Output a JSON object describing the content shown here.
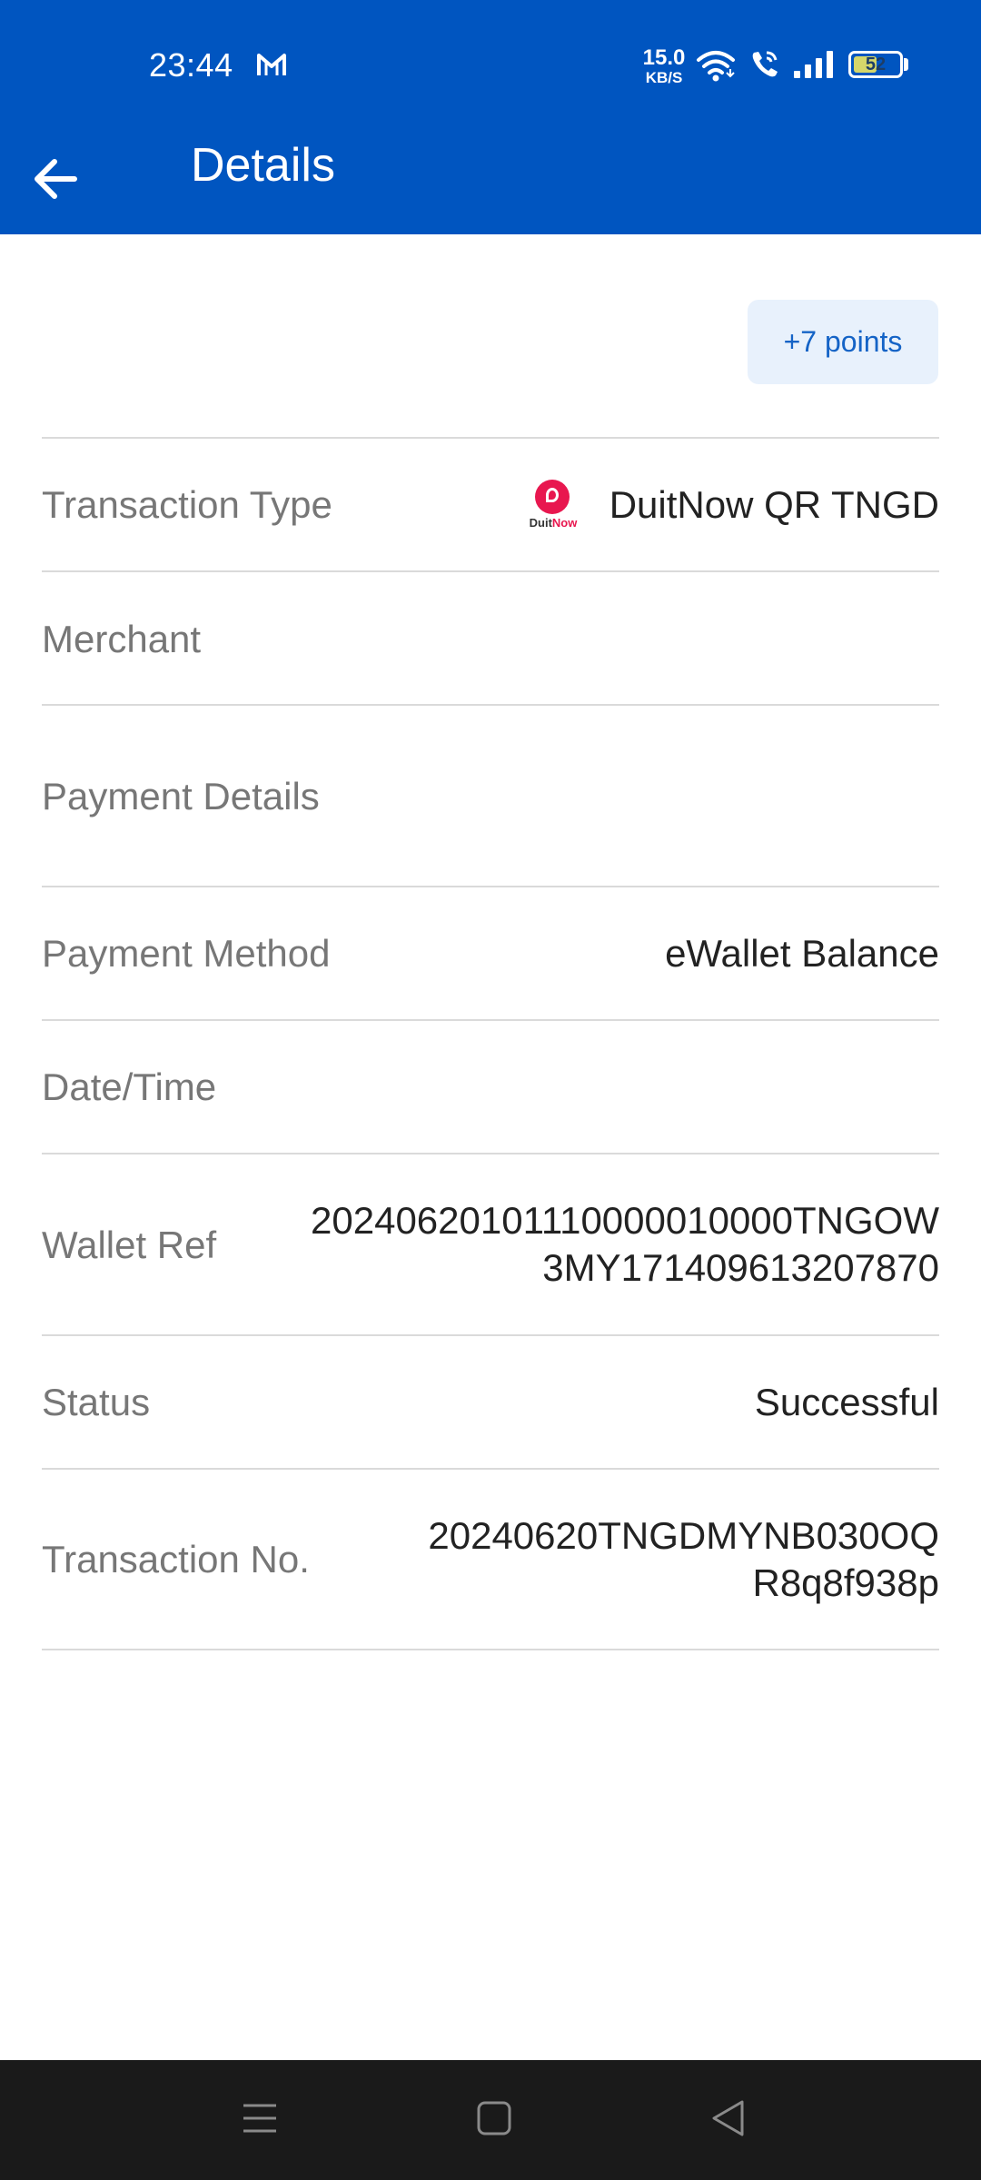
{
  "status_bar": {
    "time": "23:44",
    "net_speed_value": "15.0",
    "net_speed_unit": "KB/S",
    "battery": "52",
    "battery_level": 0.52,
    "icons": [
      "gmail-icon",
      "wifi-icon",
      "wifi-call-icon",
      "signal-icon",
      "battery-icon"
    ]
  },
  "app_bar": {
    "title": "Details",
    "back_icon": "arrow-left-icon"
  },
  "points": "+7 points",
  "rows": {
    "transaction_type": {
      "label": "Transaction Type",
      "value": "DuitNow QR TNGD",
      "logo_text_a": "Duit",
      "logo_text_b": "Now"
    },
    "merchant": {
      "label": "Merchant",
      "value": ""
    },
    "payment_details": {
      "label": "Payment Details",
      "value": ""
    },
    "payment_method": {
      "label": "Payment Method",
      "value": "eWallet Balance"
    },
    "date_time": {
      "label": "Date/Time",
      "value": ""
    },
    "wallet_ref": {
      "label": "Wallet Ref",
      "value_line1": "20240620101110000010000TNGOW",
      "value_line2": "3MY171409613207870"
    },
    "status": {
      "label": "Status",
      "value": "Successful"
    },
    "transaction_no": {
      "label": "Transaction No.",
      "value_line1": "20240620TNGDMYNB030OQ",
      "value_line2": "R8q8f938p"
    }
  },
  "colors": {
    "header": "#0055c0",
    "points_bg": "#e8f1fc",
    "points_text": "#1463c6",
    "label": "#777777",
    "value": "#222222",
    "nav_bar": "#1a1a1a",
    "duitnow_brand": "#e8174f"
  },
  "nav_bar": {
    "icons": [
      "menu-icon",
      "home-icon",
      "back-triangle-icon"
    ]
  }
}
